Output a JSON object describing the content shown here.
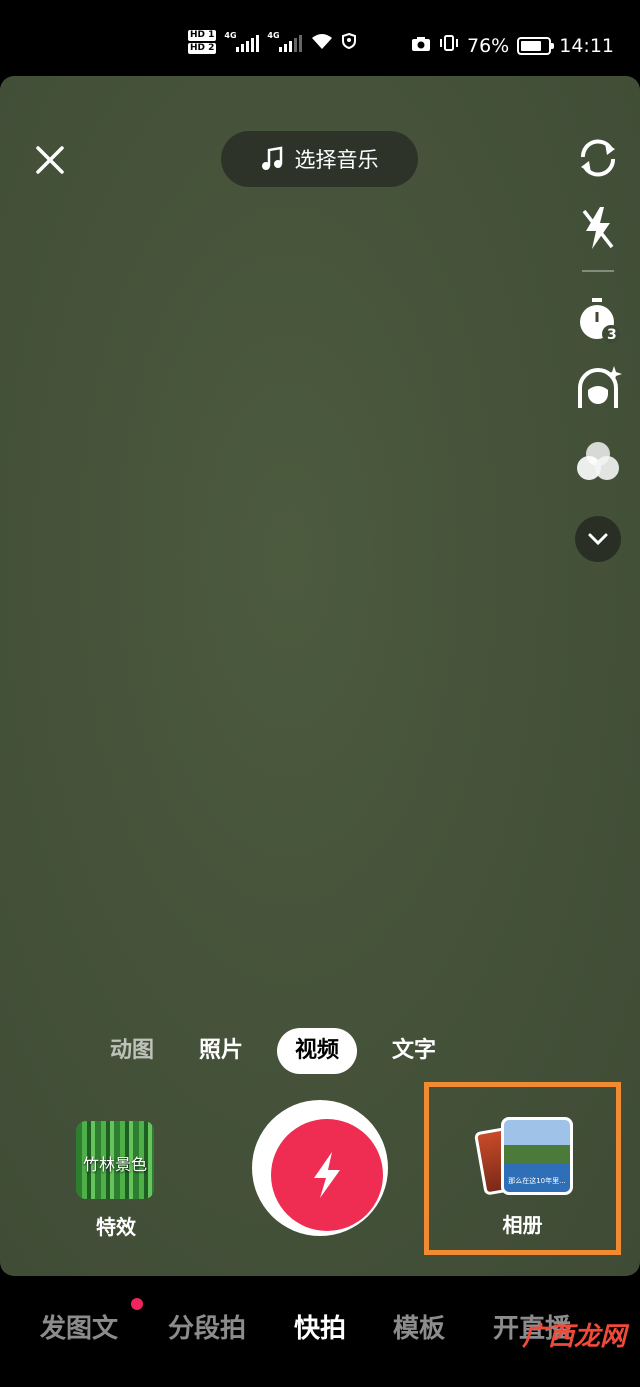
{
  "status_bar": {
    "hd1": "HD 1",
    "hd2": "HD 2",
    "net1": "4G",
    "net2": "4G",
    "wifi_label": "6",
    "battery": "76%",
    "battery_level": 0.76,
    "time": "14:11"
  },
  "top": {
    "music_label": "选择音乐"
  },
  "modes": {
    "items": [
      "动图",
      "照片",
      "视频",
      "文字"
    ],
    "selected": "视频"
  },
  "effects": {
    "thumb_text": "竹林景色",
    "label": "特效"
  },
  "album": {
    "label": "相册",
    "photo_caption": "那么在这10年里..."
  },
  "bottom_nav": {
    "items": [
      "发图文",
      "分段拍",
      "快拍",
      "模板",
      "开直播"
    ],
    "active": "快拍"
  },
  "watermark": "广西龙网",
  "colors": {
    "shutter": "#ef2d53",
    "highlight_box": "#f28b30",
    "notification_dot": "#f0245f"
  },
  "icons": [
    "close-icon",
    "music-note-icon",
    "flip-camera-icon",
    "flash-off-icon",
    "timer-icon",
    "beauty-icon",
    "filter-icon",
    "chevron-down-icon",
    "lightning-icon"
  ]
}
